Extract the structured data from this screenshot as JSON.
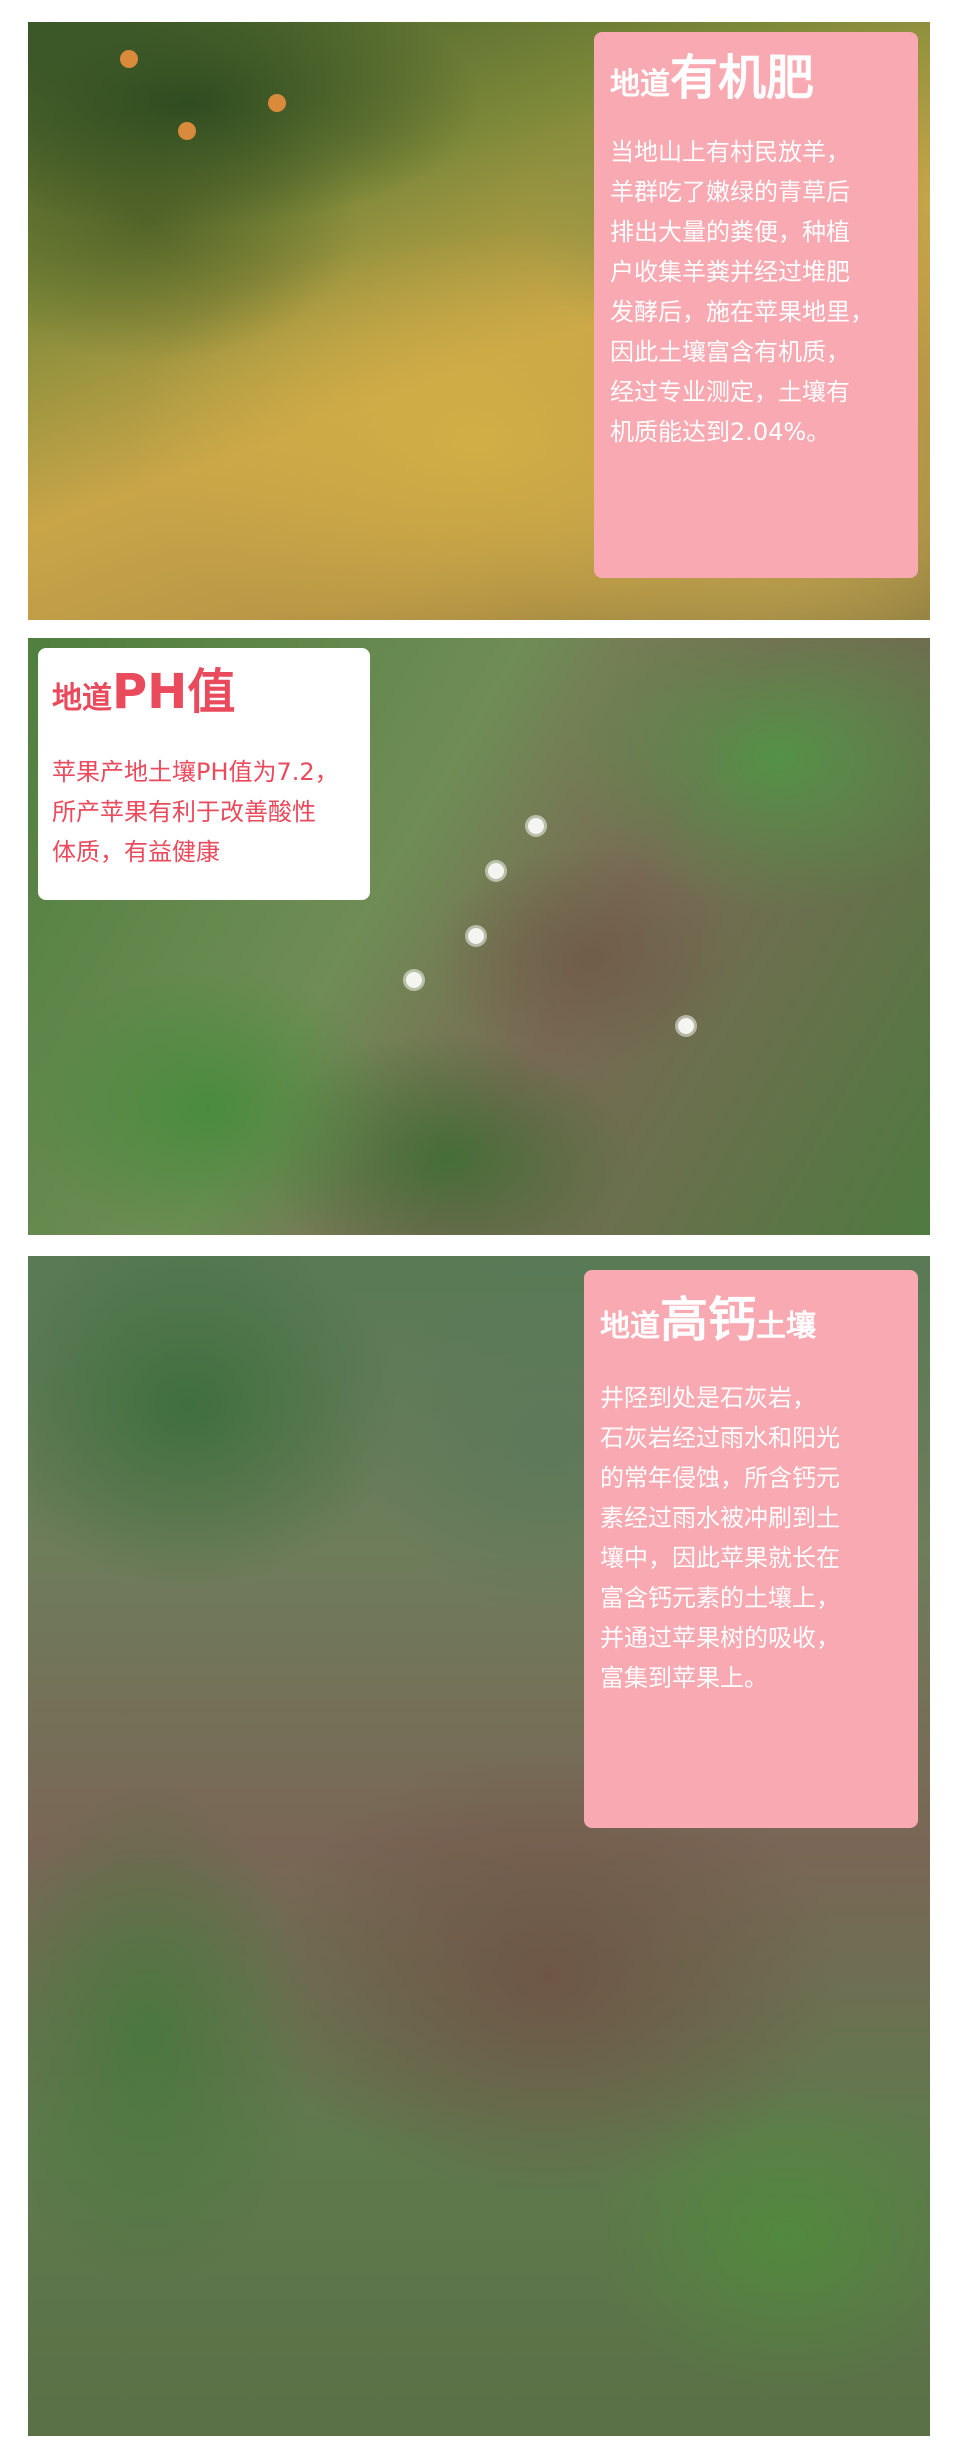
{
  "section1": {
    "title_prefix": "地道",
    "title_main": "有机肥",
    "body_lines": [
      "当地山上有村民放羊，",
      "羊群吃了嫩绿的青草后",
      "排出大量的粪便，种植",
      "户收集羊粪并经过堆肥",
      "发酵后，施在苹果地里，",
      "因此土壤富含有机质，",
      "经过专业测定，土壤有",
      "机质能达到2.04%。"
    ]
  },
  "section2": {
    "title_prefix": "地道",
    "title_main": "PH值",
    "body_lines": [
      "苹果产地土壤PH值为7.2，",
      "所产苹果有利于改善酸性",
      "体质，有益健康"
    ]
  },
  "section3": {
    "title_prefix": "地道",
    "title_main": "高钙",
    "title_suffix": "土壤",
    "body_lines": [
      "井陉到处是石灰岩，",
      "石灰岩经过雨水和阳光",
      "的常年侵蚀，所含钙元",
      "素经过雨水被冲刷到土",
      "壤中，因此苹果就长在",
      "富含钙元素的土壤上，",
      "并通过苹果树的吸收，",
      "富集到苹果上。"
    ]
  },
  "colors": {
    "card_pink": "#f8a9b1",
    "accent_red": "#e94b5d",
    "white": "#ffffff"
  }
}
